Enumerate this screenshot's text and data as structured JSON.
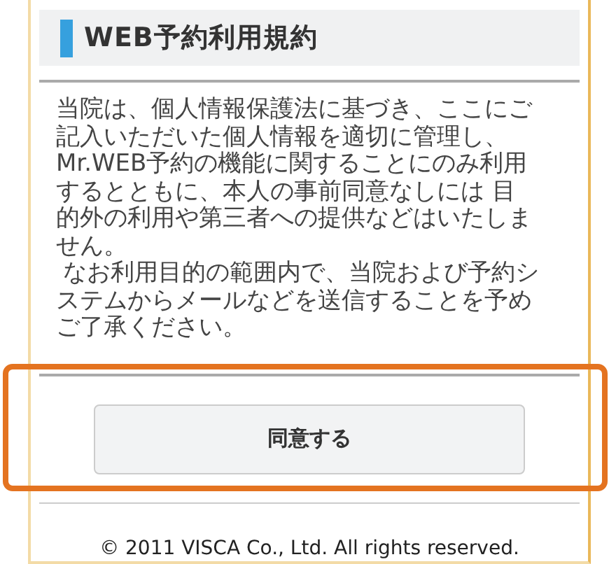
{
  "heading": {
    "title": "WEB予約利用規約"
  },
  "terms": {
    "paragraphs": [
      "当院は、個人情報保護法に基づき、ここにご記入いただいた個人情報を適切に管理し、Mr.WEB予約の機能に関することにのみ利用するとともに、本人の事前同意なしには 目的外の利用や第三者への提供などはいたしません。",
      "なお利用目的の範囲内で、当院および予約システムからメールなどを送信することを予めご了承ください。"
    ]
  },
  "agree_button": {
    "label": "同意する",
    "highlighted": true
  },
  "footer": {
    "copyright": "© 2011 VISCA Co., Ltd. All rights reserved."
  }
}
